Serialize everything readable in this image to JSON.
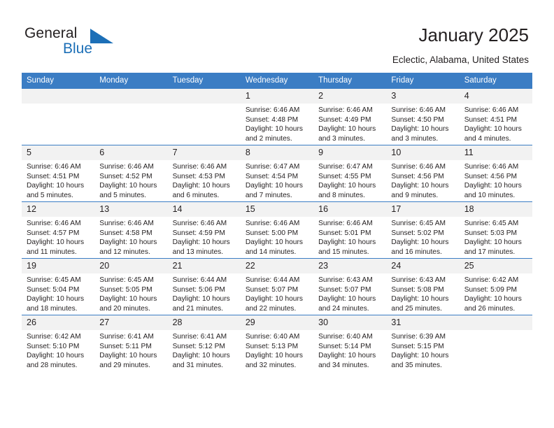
{
  "brand": {
    "name_part1": "General",
    "name_part2": "Blue"
  },
  "header": {
    "title": "January 2025",
    "location": "Eclectic, Alabama, United States"
  },
  "colors": {
    "header_blue": "#3b7dc4",
    "logo_blue": "#1c6fb7",
    "daynum_band": "#f2f2f2",
    "text": "#231f20"
  },
  "weekdays": [
    "Sunday",
    "Monday",
    "Tuesday",
    "Wednesday",
    "Thursday",
    "Friday",
    "Saturday"
  ],
  "labels": {
    "sunrise": "Sunrise:",
    "sunset": "Sunset:",
    "daylight": "Daylight:"
  },
  "weeks": [
    [
      {
        "day": "",
        "sunrise": "",
        "sunset": "",
        "daylight": "",
        "blank": true
      },
      {
        "day": "",
        "sunrise": "",
        "sunset": "",
        "daylight": "",
        "blank": true
      },
      {
        "day": "",
        "sunrise": "",
        "sunset": "",
        "daylight": "",
        "blank": true
      },
      {
        "day": "1",
        "sunrise": "Sunrise: 6:46 AM",
        "sunset": "Sunset: 4:48 PM",
        "daylight": "Daylight: 10 hours and 2 minutes."
      },
      {
        "day": "2",
        "sunrise": "Sunrise: 6:46 AM",
        "sunset": "Sunset: 4:49 PM",
        "daylight": "Daylight: 10 hours and 3 minutes."
      },
      {
        "day": "3",
        "sunrise": "Sunrise: 6:46 AM",
        "sunset": "Sunset: 4:50 PM",
        "daylight": "Daylight: 10 hours and 3 minutes."
      },
      {
        "day": "4",
        "sunrise": "Sunrise: 6:46 AM",
        "sunset": "Sunset: 4:51 PM",
        "daylight": "Daylight: 10 hours and 4 minutes."
      }
    ],
    [
      {
        "day": "5",
        "sunrise": "Sunrise: 6:46 AM",
        "sunset": "Sunset: 4:51 PM",
        "daylight": "Daylight: 10 hours and 5 minutes."
      },
      {
        "day": "6",
        "sunrise": "Sunrise: 6:46 AM",
        "sunset": "Sunset: 4:52 PM",
        "daylight": "Daylight: 10 hours and 5 minutes."
      },
      {
        "day": "7",
        "sunrise": "Sunrise: 6:46 AM",
        "sunset": "Sunset: 4:53 PM",
        "daylight": "Daylight: 10 hours and 6 minutes."
      },
      {
        "day": "8",
        "sunrise": "Sunrise: 6:47 AM",
        "sunset": "Sunset: 4:54 PM",
        "daylight": "Daylight: 10 hours and 7 minutes."
      },
      {
        "day": "9",
        "sunrise": "Sunrise: 6:47 AM",
        "sunset": "Sunset: 4:55 PM",
        "daylight": "Daylight: 10 hours and 8 minutes."
      },
      {
        "day": "10",
        "sunrise": "Sunrise: 6:46 AM",
        "sunset": "Sunset: 4:56 PM",
        "daylight": "Daylight: 10 hours and 9 minutes."
      },
      {
        "day": "11",
        "sunrise": "Sunrise: 6:46 AM",
        "sunset": "Sunset: 4:56 PM",
        "daylight": "Daylight: 10 hours and 10 minutes."
      }
    ],
    [
      {
        "day": "12",
        "sunrise": "Sunrise: 6:46 AM",
        "sunset": "Sunset: 4:57 PM",
        "daylight": "Daylight: 10 hours and 11 minutes."
      },
      {
        "day": "13",
        "sunrise": "Sunrise: 6:46 AM",
        "sunset": "Sunset: 4:58 PM",
        "daylight": "Daylight: 10 hours and 12 minutes."
      },
      {
        "day": "14",
        "sunrise": "Sunrise: 6:46 AM",
        "sunset": "Sunset: 4:59 PM",
        "daylight": "Daylight: 10 hours and 13 minutes."
      },
      {
        "day": "15",
        "sunrise": "Sunrise: 6:46 AM",
        "sunset": "Sunset: 5:00 PM",
        "daylight": "Daylight: 10 hours and 14 minutes."
      },
      {
        "day": "16",
        "sunrise": "Sunrise: 6:46 AM",
        "sunset": "Sunset: 5:01 PM",
        "daylight": "Daylight: 10 hours and 15 minutes."
      },
      {
        "day": "17",
        "sunrise": "Sunrise: 6:45 AM",
        "sunset": "Sunset: 5:02 PM",
        "daylight": "Daylight: 10 hours and 16 minutes."
      },
      {
        "day": "18",
        "sunrise": "Sunrise: 6:45 AM",
        "sunset": "Sunset: 5:03 PM",
        "daylight": "Daylight: 10 hours and 17 minutes."
      }
    ],
    [
      {
        "day": "19",
        "sunrise": "Sunrise: 6:45 AM",
        "sunset": "Sunset: 5:04 PM",
        "daylight": "Daylight: 10 hours and 18 minutes."
      },
      {
        "day": "20",
        "sunrise": "Sunrise: 6:45 AM",
        "sunset": "Sunset: 5:05 PM",
        "daylight": "Daylight: 10 hours and 20 minutes."
      },
      {
        "day": "21",
        "sunrise": "Sunrise: 6:44 AM",
        "sunset": "Sunset: 5:06 PM",
        "daylight": "Daylight: 10 hours and 21 minutes."
      },
      {
        "day": "22",
        "sunrise": "Sunrise: 6:44 AM",
        "sunset": "Sunset: 5:07 PM",
        "daylight": "Daylight: 10 hours and 22 minutes."
      },
      {
        "day": "23",
        "sunrise": "Sunrise: 6:43 AM",
        "sunset": "Sunset: 5:07 PM",
        "daylight": "Daylight: 10 hours and 24 minutes."
      },
      {
        "day": "24",
        "sunrise": "Sunrise: 6:43 AM",
        "sunset": "Sunset: 5:08 PM",
        "daylight": "Daylight: 10 hours and 25 minutes."
      },
      {
        "day": "25",
        "sunrise": "Sunrise: 6:42 AM",
        "sunset": "Sunset: 5:09 PM",
        "daylight": "Daylight: 10 hours and 26 minutes."
      }
    ],
    [
      {
        "day": "26",
        "sunrise": "Sunrise: 6:42 AM",
        "sunset": "Sunset: 5:10 PM",
        "daylight": "Daylight: 10 hours and 28 minutes."
      },
      {
        "day": "27",
        "sunrise": "Sunrise: 6:41 AM",
        "sunset": "Sunset: 5:11 PM",
        "daylight": "Daylight: 10 hours and 29 minutes."
      },
      {
        "day": "28",
        "sunrise": "Sunrise: 6:41 AM",
        "sunset": "Sunset: 5:12 PM",
        "daylight": "Daylight: 10 hours and 31 minutes."
      },
      {
        "day": "29",
        "sunrise": "Sunrise: 6:40 AM",
        "sunset": "Sunset: 5:13 PM",
        "daylight": "Daylight: 10 hours and 32 minutes."
      },
      {
        "day": "30",
        "sunrise": "Sunrise: 6:40 AM",
        "sunset": "Sunset: 5:14 PM",
        "daylight": "Daylight: 10 hours and 34 minutes."
      },
      {
        "day": "31",
        "sunrise": "Sunrise: 6:39 AM",
        "sunset": "Sunset: 5:15 PM",
        "daylight": "Daylight: 10 hours and 35 minutes."
      },
      {
        "day": "",
        "sunrise": "",
        "sunset": "",
        "daylight": "",
        "blank": true
      }
    ]
  ]
}
